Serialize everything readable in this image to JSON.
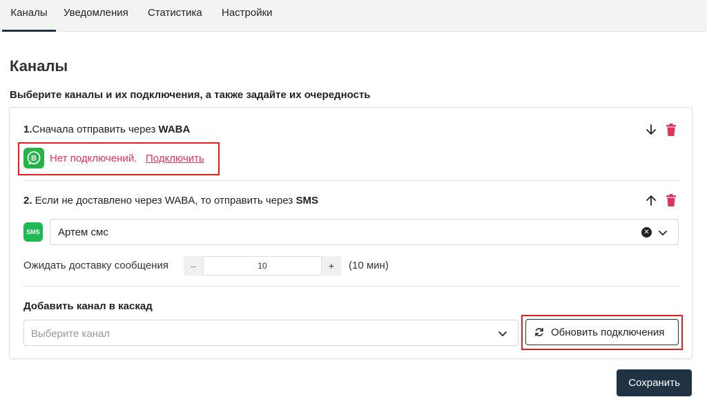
{
  "tabs": [
    {
      "label": "Каналы",
      "active": true
    },
    {
      "label": "Уведомления"
    },
    {
      "label": "Статистика"
    },
    {
      "label": "Настройки"
    }
  ],
  "page": {
    "title": "Каналы",
    "subtitle": "Выберите каналы и их подключения, а также задайте их очередность"
  },
  "step1": {
    "number": "1.",
    "prefix": "Сначала отправить через ",
    "channel": "WABA",
    "warning": "Нет подключений.",
    "connect_link": "Подключить",
    "icon": "whatsapp-business-icon"
  },
  "step2": {
    "number": "2.",
    "prefix": " Если не доставлено через WABA, то отправить через ",
    "channel": "SMS",
    "icon_label": "SMS",
    "selected_connection": "Артем смс",
    "wait_label": "Ожидать доставку сообщения",
    "wait_value": "10",
    "wait_unit": "(10 мин)",
    "minus": "–",
    "plus": "+"
  },
  "add_channel": {
    "title": "Добавить канал в каскад",
    "placeholder": "Выберите канал",
    "refresh_label": "Обновить подключения"
  },
  "save_label": "Сохранить",
  "colors": {
    "accent_dark": "#1f3345",
    "danger": "#e0335a",
    "whatsapp_green": "#25b34a",
    "sms_green": "#1db954"
  }
}
